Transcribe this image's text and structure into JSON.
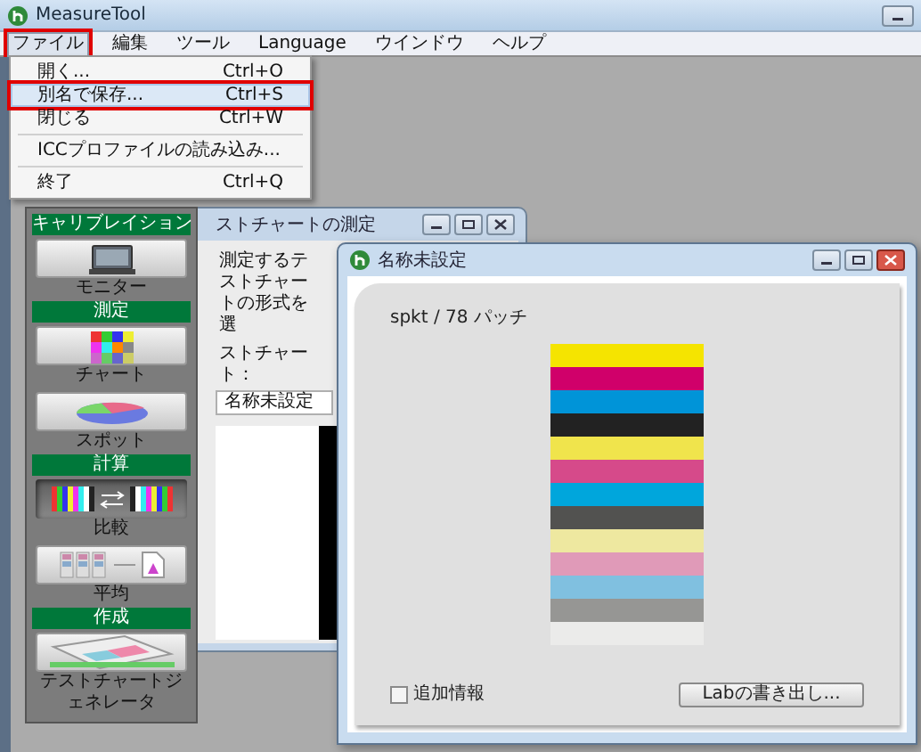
{
  "app": {
    "title": "MeasureTool"
  },
  "menu_bar": [
    {
      "label": "ファイル",
      "selected": true,
      "annotated": true
    },
    {
      "label": "編集",
      "selected": false,
      "annotated": false
    },
    {
      "label": "ツール",
      "selected": false,
      "annotated": false
    },
    {
      "label": "Language",
      "selected": false,
      "annotated": false
    },
    {
      "label": "ウインドウ",
      "selected": false,
      "annotated": false
    },
    {
      "label": "ヘルプ",
      "selected": false,
      "annotated": false
    }
  ],
  "file_menu": [
    {
      "kind": "item",
      "label": "開く...",
      "shortcut": "Ctrl+O",
      "selected": false,
      "annotated": false
    },
    {
      "kind": "item",
      "label": "別名で保存...",
      "shortcut": "Ctrl+S",
      "selected": true,
      "annotated": true
    },
    {
      "kind": "item",
      "label": "閉じる",
      "shortcut": "Ctrl+W",
      "selected": false,
      "annotated": false
    },
    {
      "kind": "separator"
    },
    {
      "kind": "item",
      "label": "ICCプロファイルの読み込み...",
      "selected": false,
      "annotated": false
    },
    {
      "kind": "separator"
    },
    {
      "kind": "item",
      "label": "終了",
      "shortcut": "Ctrl+Q",
      "selected": false,
      "annotated": false
    }
  ],
  "toolbar": [
    {
      "header": "キャリブレイション",
      "tools": [
        {
          "label": "モニター",
          "kind": "monitor",
          "selected": false
        }
      ]
    },
    {
      "header": "測定",
      "tools": [
        {
          "label": "チャート",
          "kind": "chart",
          "selected": false
        },
        {
          "label": "スポット",
          "kind": "pie",
          "selected": false
        }
      ]
    },
    {
      "header": "計算",
      "tools": [
        {
          "label": "比較",
          "kind": "compare",
          "selected": true
        },
        {
          "label": "平均",
          "kind": "average",
          "selected": false
        }
      ]
    },
    {
      "header": "作成",
      "tools": [
        {
          "label": "テストチャートジェネレータ",
          "kind": "generator",
          "selected": false
        }
      ]
    }
  ],
  "chart_window": {
    "title": "ストチャートの測定",
    "instruction": "測定するテストチャートの形式を選",
    "field_label": "ストチャート：",
    "field_value": "名称未設定"
  },
  "document_window": {
    "title": "名称未設定",
    "patch_info": "spkt / 78 パッチ",
    "patches": [
      {
        "color": "#f5e400"
      },
      {
        "color": "#d0006a"
      },
      {
        "color": "#0094d8"
      },
      {
        "color": "#222222"
      },
      {
        "color": "#f0e44c"
      },
      {
        "color": "#d64a8a"
      },
      {
        "color": "#00a6dc"
      },
      {
        "color": "#525250"
      },
      {
        "color": "#eee8a0"
      },
      {
        "color": "#e09ab8"
      },
      {
        "color": "#80c0e0"
      },
      {
        "color": "#969694"
      },
      {
        "color": "#ebebea"
      }
    ],
    "extra_info": {
      "label": "追加情報",
      "checked": false
    },
    "export_button": "Labの書き出し..."
  }
}
